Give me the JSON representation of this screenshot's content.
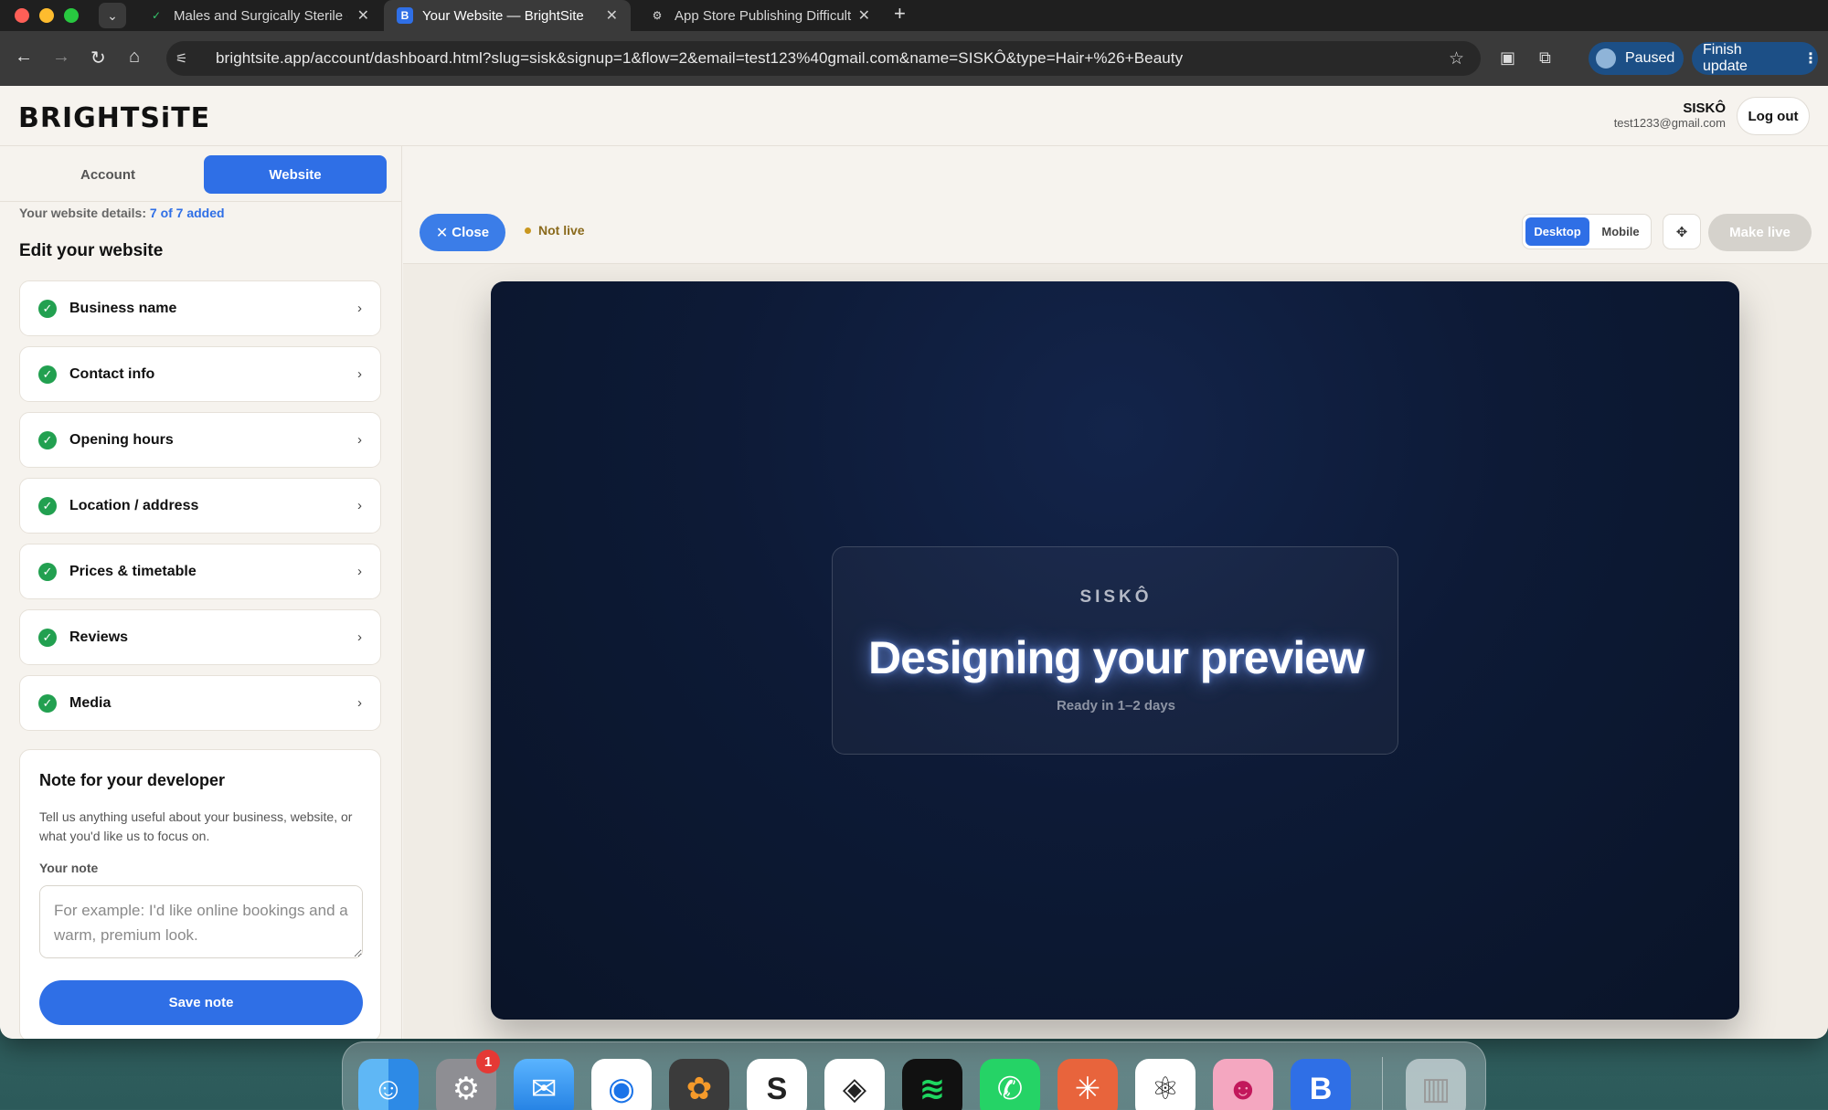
{
  "browser": {
    "tabs": [
      {
        "title": "Males and Surgically Sterile o",
        "icon_text": ""
      },
      {
        "title": "Your Website — BrightSite",
        "icon_text": "B"
      },
      {
        "title": "App Store Publishing Difficult",
        "icon_text": ""
      }
    ],
    "url": "brightsite.app/account/dashboard.html?slug=sisk&signup=1&flow=2&email=test123%40gmail.com&name=SISKÔ&type=Hair+%26+Beauty",
    "profile_label": "Paused",
    "update_label": "Finish update",
    "update_menu": "⋮"
  },
  "header": {
    "logo": "BRIGHTSiTE",
    "user_name": "SISKÔ",
    "user_email": "test1233@gmail.com",
    "logout": "Log out"
  },
  "sidebar": {
    "tabs": {
      "account": "Account",
      "website": "Website"
    },
    "details_prefix": "Your website details:",
    "details_count": "7 of 7 added",
    "edit_title": "Edit your website",
    "items": [
      {
        "label": "Business name"
      },
      {
        "label": "Contact info"
      },
      {
        "label": "Opening hours"
      },
      {
        "label": "Location / address"
      },
      {
        "label": "Prices & timetable"
      },
      {
        "label": "Reviews"
      },
      {
        "label": "Media"
      }
    ],
    "note": {
      "title": "Note for your developer",
      "description": "Tell us anything useful about your business, website, or what you'd like us to focus on.",
      "label": "Your note",
      "placeholder": "For example: I'd like online bookings and a warm, premium look.",
      "value": "",
      "save": "Save note"
    }
  },
  "main": {
    "close": "Close",
    "status": "Not live",
    "view_desktop": "Desktop",
    "view_mobile": "Mobile",
    "make_live": "Make live",
    "preview": {
      "brand": "SISKÔ",
      "title": "Designing your preview",
      "subtitle": "Ready in 1–2 days"
    }
  },
  "dock": {
    "apps": [
      "Finder",
      "System Settings",
      "Mail",
      "Chrome",
      "Fruity Loops",
      "Scrivener",
      "Blender",
      "Spotify",
      "WhatsApp",
      "Claude",
      "ChatGPT",
      "Robot",
      "BrightSite",
      "Trash"
    ],
    "settings_badge": "1"
  },
  "colors": {
    "accent": "#2f6fe6",
    "success": "#22a050",
    "status_amber": "#c9971f",
    "preview_bg": "#0d1a36"
  }
}
